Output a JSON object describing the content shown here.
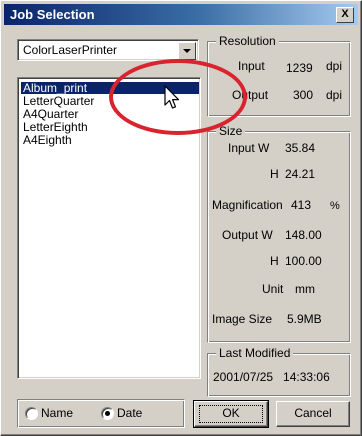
{
  "window": {
    "title": "Job Selection",
    "close_label": "X"
  },
  "printer": {
    "selected": "ColorLaserPrinter"
  },
  "jobs": {
    "items": [
      "Album_print",
      "LetterQuarter",
      "A4Quarter",
      "LetterEighth",
      "A4Eighth"
    ],
    "selected_index": 0
  },
  "resolution": {
    "label": "Resolution",
    "input_label": "Input",
    "input_value": "1239",
    "input_unit": "dpi",
    "output_label": "Output",
    "output_value": "300",
    "output_unit": "dpi"
  },
  "size": {
    "label": "Size",
    "input_w_label": "Input W",
    "input_w_value": "35.84",
    "input_h_label": "H",
    "input_h_value": "24.21",
    "magnification_label": "Magnification",
    "magnification_value": "413",
    "magnification_unit": "%",
    "output_w_label": "Output W",
    "output_w_value": "148.00",
    "output_h_label": "H",
    "output_h_value": "100.00",
    "unit_label": "Unit",
    "unit_value": "mm",
    "image_size_label": "Image Size",
    "image_size_value": "5.9MB"
  },
  "last_modified": {
    "label": "Last Modified",
    "value": "2001/07/25   14:33:06"
  },
  "sort": {
    "name_label": "Name",
    "date_label": "Date",
    "selected": "Date"
  },
  "buttons": {
    "ok": "OK",
    "cancel": "Cancel"
  },
  "colors": {
    "annotation": "#d9232e",
    "selection": "#0a246a",
    "face": "#d4d0c8"
  },
  "icons": {
    "close": "close-icon",
    "dropdown": "chevron-down-icon",
    "cursor": "mouse-pointer-icon"
  }
}
